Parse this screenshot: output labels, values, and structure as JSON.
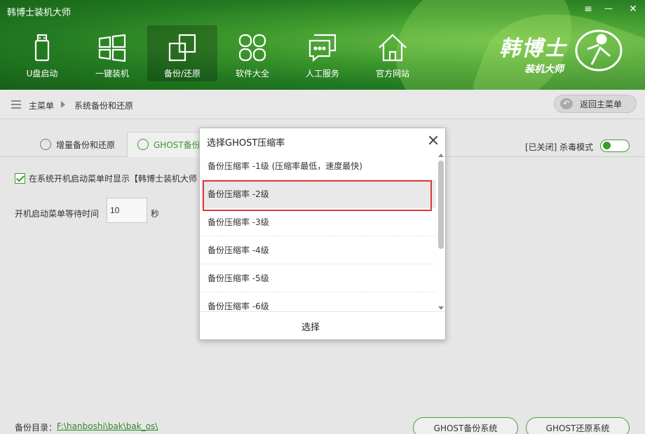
{
  "app": {
    "title": "韩博士装机大师"
  },
  "window_controls": {
    "menu": "≡",
    "minimize": "—",
    "close": "✕"
  },
  "nav": [
    {
      "label": "U盘启动",
      "icon": "usb-drive-icon"
    },
    {
      "label": "一键装机",
      "icon": "windows-icon"
    },
    {
      "label": "备份/还原",
      "icon": "backup-icon",
      "active": true
    },
    {
      "label": "软件大全",
      "icon": "apps-grid-icon"
    },
    {
      "label": "人工服务",
      "icon": "chat-icon"
    },
    {
      "label": "官方网站",
      "icon": "home-icon"
    }
  ],
  "brand": {
    "name": "韩博士",
    "subtitle": "装机大师"
  },
  "breadcrumb": {
    "root": "主菜单",
    "current": "系统备份和还原"
  },
  "back_button": {
    "label": "返回主菜单"
  },
  "tabs": [
    {
      "label": "增量备份和还原"
    },
    {
      "label": "GHOST备份"
    }
  ],
  "antivirus": {
    "status_label": "[已关闭] 杀毒模式",
    "enabled": false
  },
  "settings": {
    "show_menu_label": "在系统开机启动菜单时显示【韩博士装机大师",
    "show_menu_checked": true,
    "wait_label": "开机启动菜单等待时间",
    "wait_value": "10",
    "wait_unit": "秒"
  },
  "backup_dir": {
    "label": "备份目录：",
    "path": "F:\\hanboshi\\bak\\bak_os\\"
  },
  "buttons": {
    "ghost_backup": "GHOST备份系统",
    "ghost_restore": "GHOST还原系统"
  },
  "dialog": {
    "title": "选择GHOST压缩率",
    "options": [
      "备份压缩率 -1级   (压缩率最低，速度最快)",
      "备份压缩率 -2级",
      "备份压缩率 -3级",
      "备份压缩率 -4级",
      "备份压缩率 -5级",
      "备份压缩率 -6级"
    ],
    "selected_index": 1,
    "confirm": "选择"
  },
  "colors": {
    "accent": "#3d9a2d",
    "highlight_border": "#d93a3a"
  }
}
